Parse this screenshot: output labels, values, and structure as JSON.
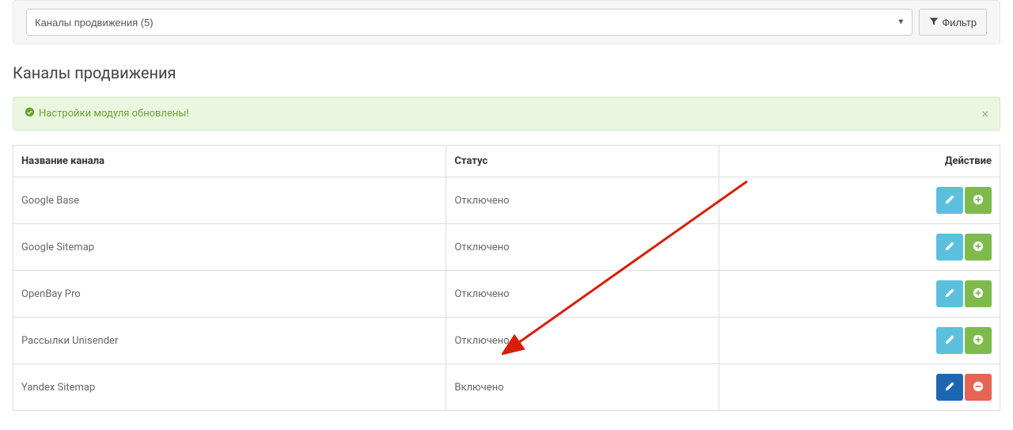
{
  "filter": {
    "select_label": "Каналы продвижения (5)",
    "button_label": "Фильтр"
  },
  "page_title": "Каналы продвижения",
  "alert": {
    "message": "Настройки модуля обновлены!"
  },
  "table": {
    "headers": {
      "name": "Название канала",
      "status": "Статус",
      "action": "Действие"
    },
    "rows": [
      {
        "name": "Google Base",
        "status": "Отключено",
        "variant": "inactive"
      },
      {
        "name": "Google Sitemap",
        "status": "Отключено",
        "variant": "inactive"
      },
      {
        "name": "OpenBay Pro",
        "status": "Отключено",
        "variant": "inactive"
      },
      {
        "name": "Рассылки Unisender",
        "status": "Отключено",
        "variant": "inactive"
      },
      {
        "name": "Yandex Sitemap",
        "status": "Включено",
        "variant": "active"
      }
    ]
  }
}
